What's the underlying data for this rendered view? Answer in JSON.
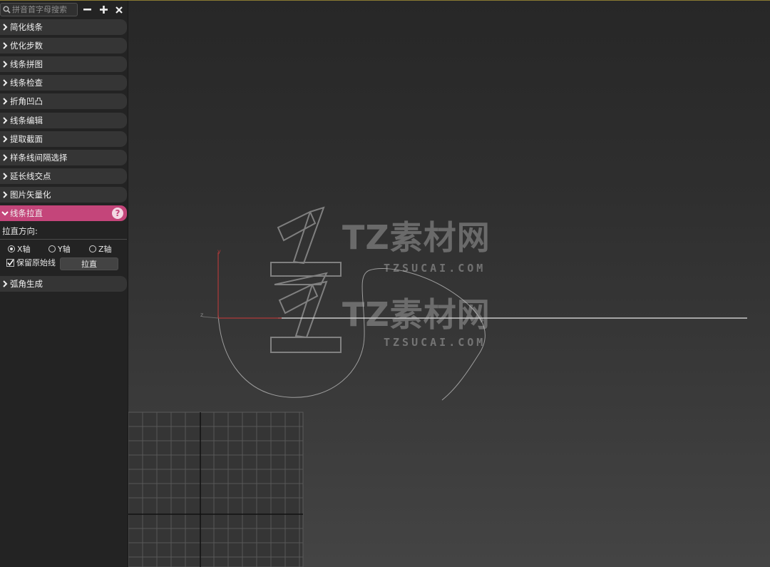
{
  "search": {
    "placeholder": "拼音首字母搜索"
  },
  "toolbar": {
    "minus_icon": "minus-icon",
    "plus_icon": "plus-icon",
    "close_icon": "close-icon"
  },
  "rollouts": [
    {
      "label": "简化线条"
    },
    {
      "label": "优化步数"
    },
    {
      "label": "线条拼图"
    },
    {
      "label": "线条检查"
    },
    {
      "label": "折角凹凸"
    },
    {
      "label": "线条编辑"
    },
    {
      "label": "提取截面"
    },
    {
      "label": "样条线间隔选择"
    },
    {
      "label": "延长线交点"
    },
    {
      "label": "图片矢量化"
    }
  ],
  "active_rollout": {
    "label": "线条拉直",
    "help": "?",
    "direction_label": "拉直方向:",
    "axes": [
      {
        "label": "X轴",
        "checked": true
      },
      {
        "label": "Y轴",
        "checked": false
      },
      {
        "label": "Z轴",
        "checked": false
      }
    ],
    "keep_original_label": "保留原始线",
    "keep_original_checked": true,
    "straighten_button": "拉直"
  },
  "last_rollout": {
    "label": "弧角生成"
  },
  "viewport": {
    "axis_y_label": "y",
    "axis_z_label": "z",
    "watermark": {
      "title": "TZ素材网",
      "url": "TZSUCAI.COM"
    }
  },
  "colors": {
    "accent": "#c4457a",
    "panel": "#232323",
    "rollout": "#353535",
    "axis_red": "#b03a3a"
  }
}
